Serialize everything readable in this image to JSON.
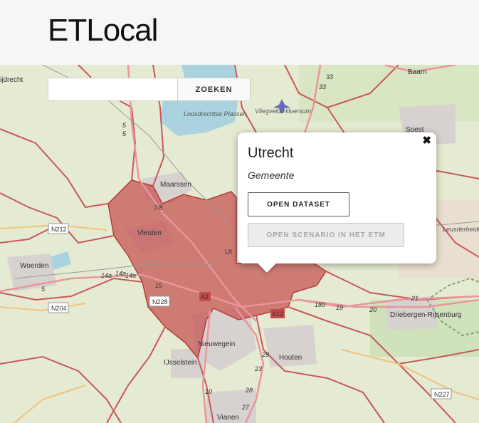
{
  "app": {
    "title": "ETLocal"
  },
  "search": {
    "value": "",
    "placeholder": "",
    "button_label": "ZOEKEN"
  },
  "popup": {
    "title": "Utrecht",
    "subtitle": "Gemeente",
    "open_dataset_label": "OPEN DATASET",
    "open_scenario_label": "OPEN SCENARIO IN HET ETM",
    "close_icon": "close-icon",
    "scenario_disabled": true
  },
  "map": {
    "selected_region_color": "#c44b4b",
    "boundary_color": "#c44b4b",
    "place_labels": {
      "mijdrecht": "ijdrecht",
      "baarn": "Baarn",
      "soest": "Soest",
      "loosdrechtse_plassen": "Loosdrechtse Plassen",
      "vliegveld": "Vliegveld Hilversum",
      "maarssen": "Maarssen",
      "vleuten": "Vleuten",
      "utrecht_partial": "Ut",
      "woerden": "Woerden",
      "nieuwegein": "Nieuwegein",
      "ijsselstein": "IJsselstein",
      "houten": "Houten",
      "driebergen": "Driebergen-Rijsenburg",
      "leusderheide": "Leusderheide",
      "vianen": "Vianen"
    },
    "road_labels": {
      "n212": "N212",
      "n204": "N204",
      "n228": "N228",
      "n227": "N227",
      "a2": "A2",
      "a12": "A12",
      "r14a_1": "14a",
      "r14a_2": "14a",
      "r14a_3": "14a",
      "r15": "15",
      "r7_8": "7/8",
      "r180": "180",
      "r19": "19",
      "r20": "20",
      "r21": "21",
      "r33a": "33",
      "r33b": "33",
      "r5a": "5",
      "r5b": "5",
      "r27": "27",
      "r28": "28",
      "r29": "29",
      "r10": "10",
      "r23": "23",
      "r5c": "5"
    }
  }
}
